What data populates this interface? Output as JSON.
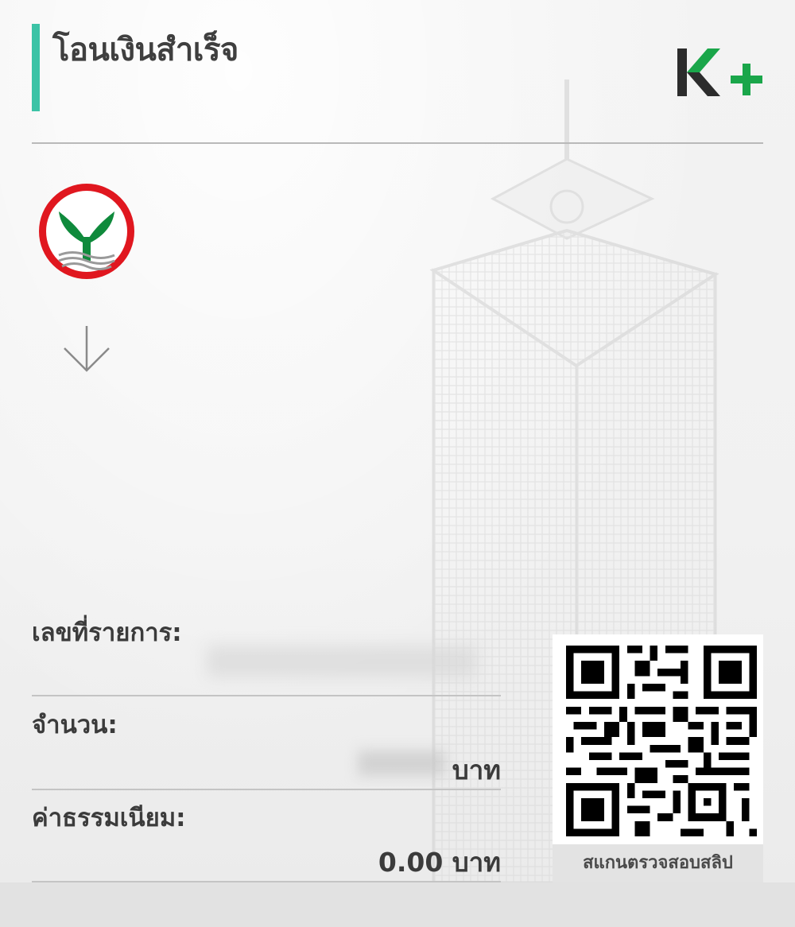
{
  "header": {
    "title": "โอนเงินสำเร็จ",
    "brand_icon": "k-plus-logo"
  },
  "sender": {
    "bank_icon": "kasikorn-bank-logo"
  },
  "transfer_arrow_icon": "down-arrow-icon",
  "details": {
    "ref_label": "เลขที่รายการ:",
    "amount_label": "จำนวน:",
    "amount_currency": "บาท",
    "fee_label": "ค่าธรรมเนียม:",
    "fee_value": "0.00 บาท"
  },
  "qr": {
    "caption": "สแกนตรวจสอบสลิป"
  },
  "colors": {
    "accent": "#3cc3a6",
    "brand_green": "#1aa64a",
    "bank_red": "#e0171f",
    "bank_green": "#0f8a3c"
  }
}
